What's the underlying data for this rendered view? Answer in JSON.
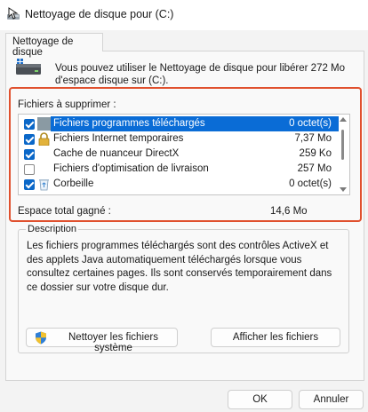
{
  "window": {
    "title": "Nettoyage de disque pour  (C:)"
  },
  "tab": {
    "label": "Nettoyage de disque"
  },
  "intro": {
    "text": "Vous pouvez utiliser le Nettoyage de disque pour libérer 272 Mo d'espace disque sur  (C:)."
  },
  "files": {
    "label": "Fichiers à supprimer :",
    "items": [
      {
        "name": "Fichiers programmes téléchargés",
        "size": "0 octet(s)",
        "checked": true,
        "selected": true,
        "icon": "folder-icon"
      },
      {
        "name": "Fichiers Internet temporaires",
        "size": "7,37 Mo",
        "checked": true,
        "selected": false,
        "icon": "lock-icon"
      },
      {
        "name": "Cache de nuanceur DirectX",
        "size": "259 Ko",
        "checked": true,
        "selected": false,
        "icon": "blank-file-icon"
      },
      {
        "name": "Fichiers d'optimisation de livraison",
        "size": "257 Mo",
        "checked": false,
        "selected": false,
        "icon": "blank-file-icon"
      },
      {
        "name": "Corbeille",
        "size": "0 octet(s)",
        "checked": true,
        "selected": false,
        "icon": "recycle-bin-icon"
      }
    ]
  },
  "total": {
    "label": "Espace total gagné :",
    "value": "14,6 Mo"
  },
  "description": {
    "legend": "Description",
    "text": "Les fichiers programmes téléchargés sont des contrôles ActiveX et des applets Java automatiquement téléchargés lorsque vous consultez certaines pages. Ils sont conservés temporairement dans ce dossier sur votre disque dur."
  },
  "buttons": {
    "system": "Nettoyer les fichiers système",
    "view": "Afficher les fichiers",
    "ok": "OK",
    "cancel": "Annuler"
  },
  "colors": {
    "accent": "#0a67c8",
    "selection": "#0a6cd6",
    "highlight_frame": "#e0502e"
  }
}
